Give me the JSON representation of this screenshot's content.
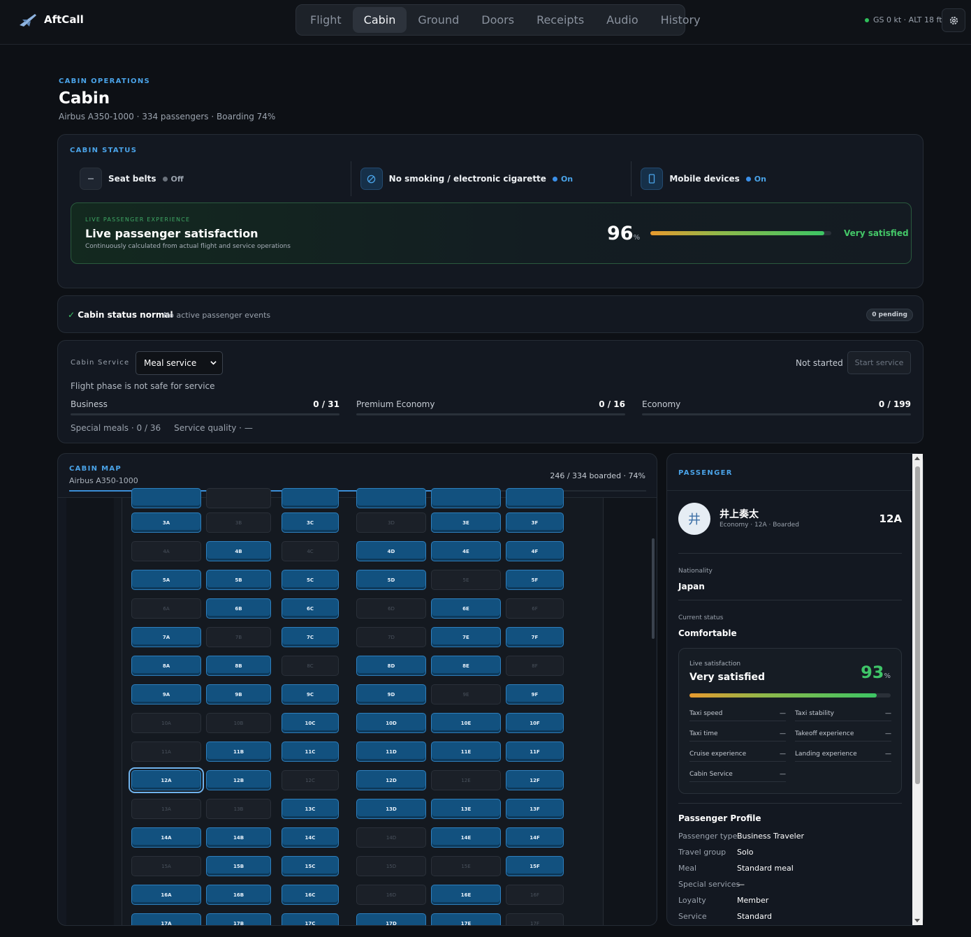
{
  "app": {
    "name": "AftCall",
    "readout": "GS 0 kt · ALT 18 ft"
  },
  "nav": {
    "tabs": [
      "Flight",
      "Cabin",
      "Ground",
      "Doors",
      "Receipts",
      "Audio",
      "History"
    ],
    "active": "Cabin"
  },
  "header": {
    "eyebrow": "CABIN OPERATIONS",
    "title": "Cabin",
    "subtitle": "Airbus A350-1000 · 334 passengers · Boarding 74%"
  },
  "cabin_status": {
    "eyebrow": "CABIN STATUS",
    "signs": [
      {
        "label": "Seat belts",
        "state": "Off",
        "icon": "seatbelt-icon",
        "color": "#6b727c"
      },
      {
        "label": "No smoking / electronic cigarette",
        "state": "On",
        "icon": "no-smoking-icon",
        "color": "#3b8fe8"
      },
      {
        "label": "Mobile devices",
        "state": "On",
        "icon": "mobile-device-icon",
        "color": "#3b8fe8"
      }
    ],
    "live": {
      "eyebrow": "LIVE PASSENGER EXPERIENCE",
      "title": "Live passenger satisfaction",
      "desc": "Continuously calculated from actual flight and service operations",
      "value": "96",
      "unit": "%",
      "fill": 0.96,
      "label": "Very satisfied"
    }
  },
  "events": {
    "status": "Cabin status normal",
    "check": "✓",
    "detail": "No active passenger events",
    "pending": "0 pending"
  },
  "service": {
    "label": "Cabin Service",
    "select": "Meal service",
    "state": "Not started",
    "button": "Start service",
    "warning": "Flight phase is not safe for service",
    "classes": [
      {
        "name": "Business",
        "count": "0 / 31"
      },
      {
        "name": "Premium Economy",
        "count": "0 / 16"
      },
      {
        "name": "Economy",
        "count": "0 / 199"
      }
    ],
    "footer": "Special meals · 0 / 36     Service quality · —"
  },
  "cabin_map": {
    "eyebrow": "CABIN MAP",
    "aircraft": "Airbus A350-1000",
    "boarded": "246 / 334 boarded · 74%",
    "progress": 0.74,
    "rows": [
      {
        "row": 3,
        "occ": [
          1,
          0,
          1,
          0,
          1,
          1
        ]
      },
      {
        "row": 4,
        "occ": [
          0,
          1,
          0,
          1,
          1,
          1
        ]
      },
      {
        "row": 5,
        "occ": [
          1,
          1,
          1,
          1,
          0,
          1
        ]
      },
      {
        "row": 6,
        "occ": [
          0,
          1,
          1,
          0,
          1,
          0
        ]
      },
      {
        "row": 7,
        "occ": [
          1,
          0,
          1,
          0,
          1,
          1
        ]
      },
      {
        "row": 8,
        "occ": [
          1,
          1,
          0,
          1,
          1,
          0
        ]
      },
      {
        "row": 9,
        "occ": [
          1,
          1,
          1,
          1,
          0,
          1
        ]
      },
      {
        "row": 10,
        "occ": [
          0,
          0,
          1,
          1,
          1,
          1
        ]
      },
      {
        "row": 11,
        "occ": [
          0,
          1,
          1,
          1,
          1,
          1
        ]
      },
      {
        "row": 12,
        "occ": [
          1,
          1,
          0,
          1,
          0,
          1
        ]
      },
      {
        "row": 13,
        "occ": [
          0,
          0,
          1,
          1,
          1,
          1
        ]
      },
      {
        "row": 14,
        "occ": [
          1,
          1,
          1,
          0,
          1,
          1
        ]
      },
      {
        "row": 15,
        "occ": [
          0,
          1,
          1,
          0,
          0,
          1
        ]
      },
      {
        "row": 16,
        "occ": [
          1,
          1,
          1,
          0,
          1,
          0
        ]
      },
      {
        "row": 17,
        "occ": [
          1,
          1,
          1,
          1,
          1,
          0
        ]
      }
    ],
    "selected": "12A"
  },
  "passenger": {
    "eyebrow": "PASSENGER",
    "avatar": "井",
    "name": "井上奏太",
    "meta": "Economy · 12A · Boarded",
    "seat": "12A",
    "nationality_label": "Nationality",
    "nationality": "Japan",
    "status_label": "Current status",
    "status": "Comfortable",
    "sat": {
      "label": "Live satisfaction",
      "text": "Very satisfied",
      "value": "93",
      "unit": "%",
      "fill": 0.93,
      "metrics": [
        {
          "k": "Taxi speed",
          "v": "—"
        },
        {
          "k": "Taxi stability",
          "v": "—"
        },
        {
          "k": "Taxi time",
          "v": "—"
        },
        {
          "k": "Takeoff experience",
          "v": "—"
        },
        {
          "k": "Cruise experience",
          "v": "—"
        },
        {
          "k": "Landing experience",
          "v": "—"
        },
        {
          "k": "Cabin Service",
          "v": "—"
        }
      ]
    },
    "profile": {
      "title": "Passenger Profile",
      "rows": [
        {
          "k": "Passenger type",
          "v": "Business Traveler"
        },
        {
          "k": "Travel group",
          "v": "Solo"
        },
        {
          "k": "Meal",
          "v": "Standard meal"
        },
        {
          "k": "Special services",
          "v": "—"
        },
        {
          "k": "Loyalty",
          "v": "Member"
        },
        {
          "k": "Service",
          "v": "Standard"
        }
      ]
    }
  }
}
